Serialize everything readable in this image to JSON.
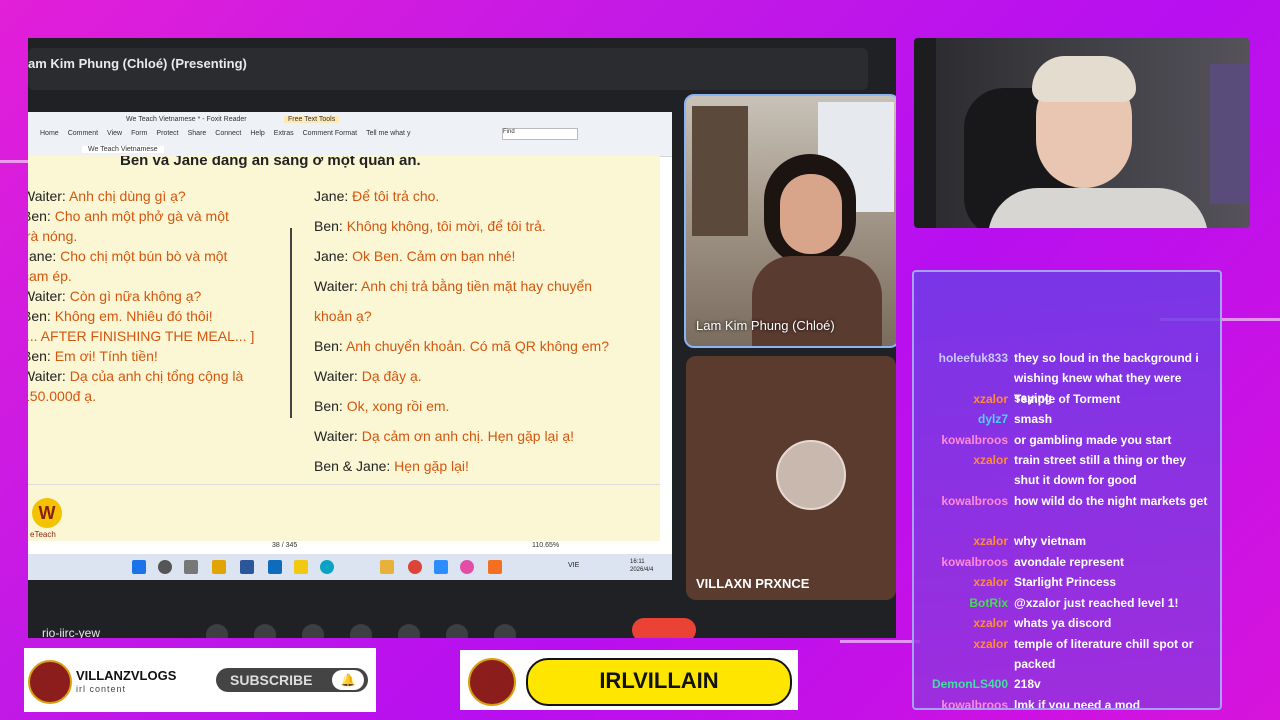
{
  "meet": {
    "title": "am Kim Phung (Chloé) (Presenting)",
    "bottom_label": "rio-iirc-yew",
    "participants": [
      {
        "name": "Lam Kim Phung (Chloé)"
      },
      {
        "name": "VILLAXN PRXNCE"
      }
    ]
  },
  "reader": {
    "window_title": "We Teach Vietnamese * - Foxit Reader",
    "tools_label": "Free Text Tools",
    "menu": [
      "Home",
      "Comment",
      "View",
      "Form",
      "Protect",
      "Share",
      "Connect",
      "Help",
      "Extras",
      "Comment Format",
      "Tell me what y"
    ],
    "tab": "We Teach Vietnamese",
    "find_placeholder": "Find",
    "page_counter": "38 / 345",
    "zoom": "110.65%",
    "taskbar_lang": "VIE",
    "taskbar_time": "16:11",
    "taskbar_date": "2026/4/4"
  },
  "document": {
    "heading": "Ben và Jane đang ăn sáng ở một quán ăn.",
    "left_lines": [
      {
        "speaker": "Waiter:",
        "text": "Anh chị dùng gì ạ?"
      },
      {
        "speaker": "Ben:",
        "text": "Cho anh một phở gà và một"
      },
      {
        "speaker": "",
        "text": "trà nóng."
      },
      {
        "speaker": "Jane:",
        "text": "Cho chị một bún bò và một"
      },
      {
        "speaker": "",
        "text": "cam ép."
      },
      {
        "speaker": "Waiter:",
        "text": "Còn gì nữa không ạ?"
      },
      {
        "speaker": "Ben:",
        "text": "Không em. Nhiêu đó thôi!"
      },
      {
        "speaker": "",
        "text": "[... AFTER FINISHING THE MEAL... ]"
      },
      {
        "speaker": "Ben:",
        "text": "Em ơi! Tính tiền!"
      },
      {
        "speaker": "Waiter:",
        "text": "Dạ của anh chị tổng cộng là"
      },
      {
        "speaker": "",
        "text": "150.000đ ạ."
      }
    ],
    "right_lines": [
      {
        "speaker": "Jane:",
        "text": "Để tôi trả cho."
      },
      {
        "speaker": "Ben:",
        "text": "Không không, tôi mời, để tôi trả."
      },
      {
        "speaker": "Jane:",
        "text": "Ok Ben. Cảm ơn bạn nhé!"
      },
      {
        "speaker": "Waiter:",
        "text": "Anh chị trả bằng tiền mặt hay chuyển"
      },
      {
        "speaker": "",
        "text": "khoản ạ?"
      },
      {
        "speaker": "Ben:",
        "text": "Anh chuyển khoản. Có mã QR không em?"
      },
      {
        "speaker": "Waiter:",
        "text": "Dạ đây ạ."
      },
      {
        "speaker": "Ben:",
        "text": "Ok, xong rồi em."
      },
      {
        "speaker": "Waiter:",
        "text": "Dạ cảm ơn anh chị. Hẹn gặp lại ạ!"
      },
      {
        "speaker": "Ben & Jane:",
        "text": "Hẹn gặp lại!"
      }
    ],
    "logo_text": "W",
    "logo_caption": "eTeach"
  },
  "chat": {
    "messages": [
      {
        "user": "holeefuk833",
        "color": "#c9c9ff",
        "text": "they so loud in the background i wishing knew what they were saying"
      },
      {
        "user": "xzalor",
        "color": "#ff8a3d",
        "text": "Temple of Torment"
      },
      {
        "user": "dylz7",
        "color": "#4fd0ff",
        "text": "smash"
      },
      {
        "user": "kowalbroos",
        "color": "#ff8ad8",
        "text": "or gambling made you start"
      },
      {
        "user": "xzalor",
        "color": "#ff8a3d",
        "text": "train street still a thing or they shut it down for good"
      },
      {
        "user": "kowalbroos",
        "color": "#ff8ad8",
        "text": "how wild do the night markets get"
      },
      {
        "user": "xzalor",
        "color": "#ff8a3d",
        "text": "why vietnam"
      },
      {
        "user": "kowalbroos",
        "color": "#ff8ad8",
        "text": "avondale represent"
      },
      {
        "user": "xzalor",
        "color": "#ff8a3d",
        "text": "Starlight Princess"
      },
      {
        "user": "BotRix",
        "color": "#40e04a",
        "text": "@xzalor just reached level 1!"
      },
      {
        "user": "xzalor",
        "color": "#ff8a3d",
        "text": "whats ya discord"
      },
      {
        "user": "xzalor",
        "color": "#ff8a3d",
        "text": "temple of literature chill spot or packed"
      },
      {
        "user": "DemonLS400",
        "color": "#40e0a0",
        "text": "218v"
      },
      {
        "user": "kowalbroos",
        "color": "#ff8ad8",
        "text": "lmk if you need a mod"
      }
    ]
  },
  "overlay": {
    "brand_name": "VILLANZVLOGS",
    "brand_sub": "irl content",
    "subscribe": "SUBSCRIBE",
    "channel": "IRLVILLAIN"
  }
}
